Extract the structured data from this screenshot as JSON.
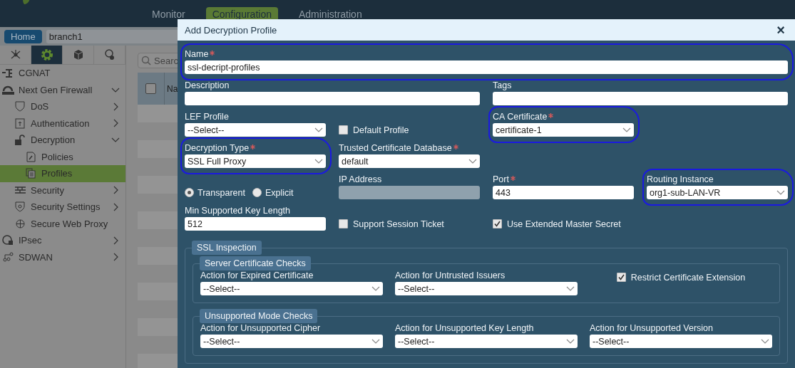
{
  "header": {
    "nav": [
      {
        "label": "Monitor",
        "selected": false
      },
      {
        "label": "Configuration",
        "selected": true
      },
      {
        "label": "Administration",
        "selected": false
      }
    ]
  },
  "toolbar": {
    "home": "Home",
    "breadcrumb": "branch1"
  },
  "sidebar": {
    "tabs": [
      {
        "selected": false
      },
      {
        "selected": true
      },
      {
        "selected": false
      },
      {
        "selected": false
      }
    ],
    "items": [
      {
        "label": "CGNAT",
        "selected": false
      },
      {
        "label": "Next Gen Firewall",
        "selected": false,
        "expanded": true,
        "children": [
          {
            "label": "DoS",
            "selected": false,
            "expanded": false
          },
          {
            "label": "Authentication",
            "selected": false,
            "expanded": false
          },
          {
            "label": "Decryption",
            "selected": false,
            "expanded": true,
            "children": [
              {
                "label": "Policies",
                "selected": false
              },
              {
                "label": "Profiles",
                "selected": true
              }
            ]
          },
          {
            "label": "Security",
            "selected": false,
            "expanded": false
          },
          {
            "label": "Security Settings",
            "selected": false,
            "expanded": false
          },
          {
            "label": "Secure Web Proxy",
            "selected": false
          }
        ]
      },
      {
        "label": "IPsec",
        "selected": false,
        "expanded": false
      },
      {
        "label": "SDWAN",
        "selected": false,
        "expanded": false
      }
    ]
  },
  "list": {
    "search_placeholder": "Searc",
    "header_checkbox": {
      "checked": false
    },
    "columns": [
      "Na"
    ]
  },
  "dialog": {
    "title": "Add Decryption Profile",
    "close": "×",
    "fields": [
      {
        "kind": "text",
        "label": "Name",
        "required": true,
        "circled": true,
        "value": "ssl-decript-profiles"
      },
      {
        "kind": "text",
        "label": "Description",
        "required": false,
        "circled": false
      },
      {
        "kind": "text",
        "label": "Tags",
        "required": false,
        "circled": false
      },
      {
        "kind": "select",
        "label": "LEF Profile",
        "required": false,
        "circled": false,
        "value": "--Select--"
      },
      {
        "kind": "checkbox",
        "label": "Default Profile",
        "checked": false
      },
      {
        "kind": "select",
        "label": "CA Certificate",
        "required": true,
        "circled": true,
        "value": "certificate-1"
      },
      {
        "kind": "select",
        "label": "Decryption Type",
        "required": true,
        "circled": true,
        "value": "SSL Full Proxy"
      },
      {
        "kind": "select",
        "label": "Trusted Certificate Database",
        "required": true,
        "circled": false,
        "value": "default"
      },
      {
        "kind": "radio",
        "options": [
          {
            "label": "Transparent",
            "selected": true
          },
          {
            "label": "Explicit",
            "selected": false
          }
        ]
      },
      {
        "kind": "disabled",
        "label": "IP Address",
        "required": false,
        "circled": false
      },
      {
        "kind": "text",
        "label": "Port",
        "required": true,
        "circled": false,
        "value": "443"
      },
      {
        "kind": "select",
        "label": "Routing Instance",
        "required": false,
        "circled": true,
        "value": "org1-sub-LAN-VR"
      },
      {
        "kind": "text",
        "label": "Min Supported Key Length",
        "required": false,
        "circled": false,
        "value": "512"
      },
      {
        "kind": "checkbox",
        "label": "Support Session Ticket",
        "checked": false
      },
      {
        "kind": "checkbox",
        "label": "Use Extended Master Secret",
        "checked": true
      }
    ],
    "section": {
      "title": "SSL Inspection",
      "groups": [
        {
          "title": "Server Certificate Checks",
          "fields": [
            {
              "kind": "select",
              "label": "Action for Expired Certificate",
              "value": "--Select--"
            },
            {
              "kind": "select",
              "label": "Action for Untrusted Issuers",
              "value": "--Select--"
            },
            {
              "kind": "checkbox",
              "label": "Restrict Certificate Extension",
              "checked": true
            }
          ]
        },
        {
          "title": "Unsupported Mode Checks",
          "fields": [
            {
              "kind": "select",
              "label": "Action for Unsupported Cipher",
              "value": "--Select--"
            },
            {
              "kind": "select",
              "label": "Action for Unsupported Key Length",
              "value": "--Select--"
            },
            {
              "kind": "select",
              "label": "Action for Unsupported Version",
              "value": "--Select--"
            }
          ]
        }
      ]
    }
  }
}
